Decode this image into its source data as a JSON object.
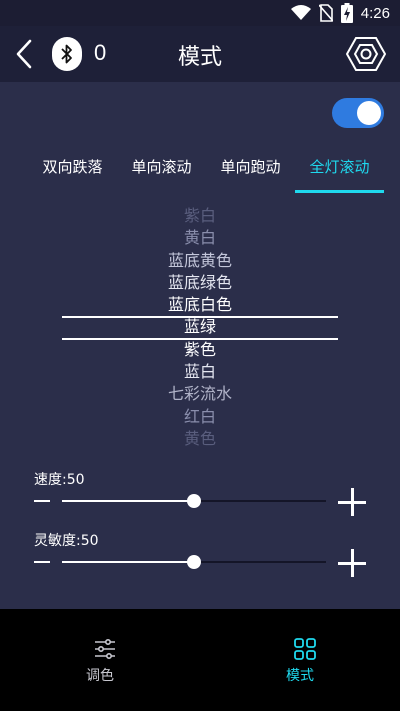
{
  "status_bar": {
    "time": "4:26",
    "icons": [
      "wifi-icon",
      "no-sim-icon",
      "battery-charging-icon"
    ]
  },
  "app_bar": {
    "title": "模式",
    "bluetooth_count": "0",
    "back_icon": "back-arrow-icon",
    "bluetooth_icon": "bluetooth-icon",
    "settings_icon": "settings-hexagon-icon"
  },
  "toggle": {
    "on": true,
    "color": "#2f7be0"
  },
  "tabs": [
    {
      "label": "双向跌落",
      "active": false
    },
    {
      "label": "单向滚动",
      "active": false
    },
    {
      "label": "单向跑动",
      "active": false
    },
    {
      "label": "全灯滚动",
      "active": true
    }
  ],
  "picker": {
    "items": [
      "紫白",
      "黄白",
      "蓝底黄色",
      "蓝底绿色",
      "蓝底白色",
      "蓝绿",
      "紫色",
      "蓝白",
      "七彩流水",
      "红白",
      "黄色"
    ],
    "selected": "蓝绿"
  },
  "speed": {
    "label": "速度:50",
    "value": 50,
    "max": 100
  },
  "sensitivity": {
    "label": "灵敏度:50",
    "value": 50,
    "max": 100
  },
  "bottom_nav": [
    {
      "label": "调色",
      "icon": "sliders-icon",
      "active": false
    },
    {
      "label": "模式",
      "icon": "grid-icon",
      "active": true
    }
  ],
  "colors": {
    "accent": "#1fd9ee",
    "background": "#2b2e4a",
    "toggle": "#2f7be0"
  }
}
